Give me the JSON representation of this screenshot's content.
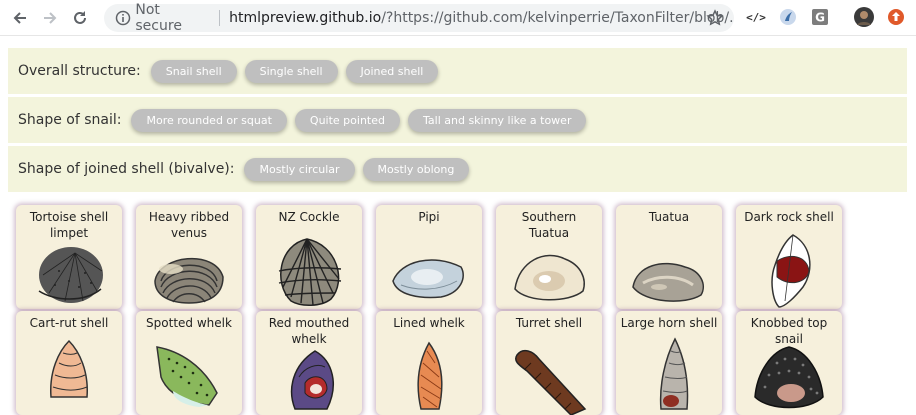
{
  "browser": {
    "security_label": "Not secure",
    "url_host": "htmlpreview.github.io",
    "url_path": "/?https://github.com/kelvinperrie/TaxonFilter/blob/...",
    "extensions": [
      "code-ext-icon",
      "flow-ext-icon",
      "grammar-ext-icon",
      "avatar",
      "update-icon"
    ]
  },
  "filters": [
    {
      "label": "Overall structure:",
      "options": [
        "Snail shell",
        "Single shell",
        "Joined shell"
      ]
    },
    {
      "label": "Shape of snail:",
      "options": [
        "More rounded or squat",
        "Quite pointed",
        "Tall and skinny like a tower"
      ]
    },
    {
      "label": "Shape of joined shell (bivalve):",
      "options": [
        "Mostly circular",
        "Mostly oblong"
      ]
    }
  ],
  "shells": [
    {
      "name": "Tortoise shell limpet",
      "kind": "limpet"
    },
    {
      "name": "Heavy ribbed venus",
      "kind": "ribbed"
    },
    {
      "name": "NZ Cockle",
      "kind": "cockle"
    },
    {
      "name": "Pipi",
      "kind": "pipi"
    },
    {
      "name": "Southern Tuatua",
      "kind": "tuatua"
    },
    {
      "name": "Tuatua",
      "kind": "tuatua2"
    },
    {
      "name": "Dark rock shell",
      "kind": "darkrock"
    },
    {
      "name": "Cart-rut shell",
      "kind": "cartrut"
    },
    {
      "name": "Spotted whelk",
      "kind": "spotted"
    },
    {
      "name": "Red mouthed whelk",
      "kind": "redmouth"
    },
    {
      "name": "Lined whelk",
      "kind": "lined"
    },
    {
      "name": "Turret shell",
      "kind": "turret"
    },
    {
      "name": "Large horn shell",
      "kind": "horn"
    },
    {
      "name": "Knobbed top snail",
      "kind": "knobbed"
    }
  ]
}
